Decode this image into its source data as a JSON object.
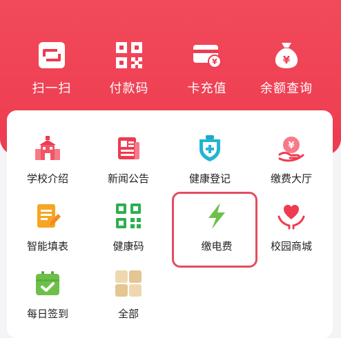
{
  "colors": {
    "header": "#ee3b50",
    "highlight": "#e24d5f",
    "text": "#222222"
  },
  "quick_actions": [
    {
      "label": "扫一扫",
      "icon": "scan-icon"
    },
    {
      "label": "付款码",
      "icon": "qr-payment-icon"
    },
    {
      "label": "卡充值",
      "icon": "card-recharge-icon"
    },
    {
      "label": "余额查询",
      "icon": "money-bag-icon"
    }
  ],
  "services": [
    {
      "label": "学校介绍",
      "icon": "school-icon"
    },
    {
      "label": "新闻公告",
      "icon": "news-icon"
    },
    {
      "label": "健康登记",
      "icon": "health-shield-icon"
    },
    {
      "label": "缴费大厅",
      "icon": "payment-hall-icon"
    },
    {
      "label": "智能填表",
      "icon": "form-edit-icon"
    },
    {
      "label": "健康码",
      "icon": "health-qr-icon"
    },
    {
      "label": "缴电费",
      "icon": "lightning-icon"
    },
    {
      "label": "校园商城",
      "icon": "heart-hands-icon"
    },
    {
      "label": "每日签到",
      "icon": "calendar-check-icon"
    },
    {
      "label": "全部",
      "icon": "all-grid-icon"
    }
  ]
}
